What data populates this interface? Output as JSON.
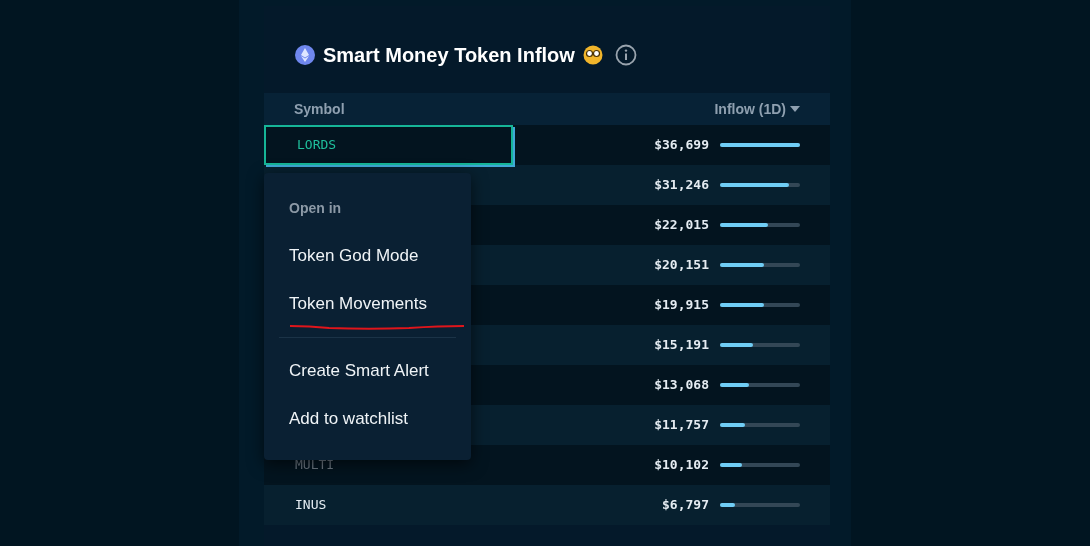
{
  "card": {
    "title": "Smart Money Token Inflow"
  },
  "table": {
    "columns": [
      "Symbol",
      "Inflow (1D)"
    ],
    "rows": [
      {
        "symbol": "LORDS",
        "inflow": "$36,699",
        "level": 1.0,
        "selected": true
      },
      {
        "inflow": "$31,246",
        "level": 0.86,
        "selected": false
      },
      {
        "inflow": "$22,015",
        "level": 0.6,
        "selected": false
      },
      {
        "inflow": "$20,151",
        "level": 0.55,
        "selected": false
      },
      {
        "inflow": "$19,915",
        "level": 0.55,
        "selected": false
      },
      {
        "inflow": "$15,191",
        "level": 0.41,
        "selected": false
      },
      {
        "inflow": "$13,068",
        "level": 0.36,
        "selected": false
      },
      {
        "inflow": "$11,757",
        "level": 0.31,
        "selected": false
      },
      {
        "symbol": "MULTI",
        "inflow": "$10,102",
        "level": 0.27,
        "selected": false
      },
      {
        "symbol": "INUS",
        "inflow": "$6,797",
        "level": 0.19,
        "selected": false
      }
    ]
  },
  "context_menu": {
    "heading": "Open in",
    "items": [
      {
        "label": "Token God Mode",
        "kind": "item",
        "underlined": false
      },
      {
        "label": "Token Movements",
        "kind": "item",
        "underlined": true
      },
      {
        "kind": "divider"
      },
      {
        "label": "Create Smart Alert",
        "kind": "item",
        "underlined": false
      },
      {
        "label": "Add to watchlist",
        "kind": "item",
        "underlined": false
      }
    ]
  }
}
